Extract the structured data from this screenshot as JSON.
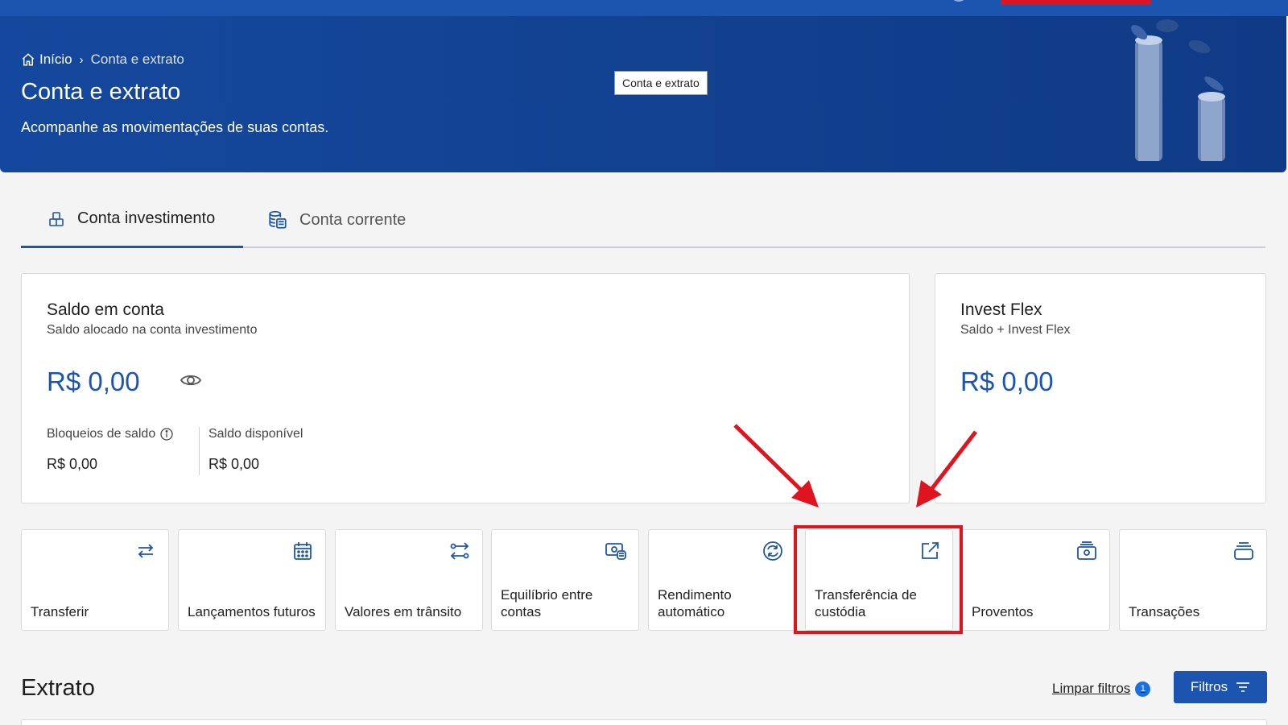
{
  "breadcrumb": {
    "home": "Início",
    "separator": "›",
    "current": "Conta e extrato"
  },
  "header": {
    "title": "Conta e extrato",
    "subtitle": "Acompanhe as movimentações de suas contas.",
    "tooltip": "Conta e extrato"
  },
  "tabs": [
    {
      "label": "Conta investimento",
      "icon": "investment-icon",
      "active": true
    },
    {
      "label": "Conta corrente",
      "icon": "coins-stack-icon",
      "active": false
    }
  ],
  "saldo": {
    "title": "Saldo em conta",
    "subtitle": "Saldo alocado na conta investimento",
    "value": "R$ 0,00",
    "bloqueios_label": "Bloqueios de saldo",
    "bloqueios_value": "R$ 0,00",
    "disponivel_label": "Saldo disponível",
    "disponivel_value": "R$ 0,00"
  },
  "invest_flex": {
    "title": "Invest Flex",
    "subtitle": "Saldo + Invest Flex",
    "value": "R$ 0,00"
  },
  "actions": [
    {
      "label": "Transferir",
      "icon": "transfer-arrows-icon"
    },
    {
      "label": "Lançamentos futuros",
      "icon": "calendar-icon"
    },
    {
      "label": "Valores em trânsito",
      "icon": "transit-arrows-icon"
    },
    {
      "label": "Equilíbrio entre contas",
      "icon": "money-balance-icon"
    },
    {
      "label": "Rendimento automático",
      "icon": "auto-yield-icon"
    },
    {
      "label": "Transferência de custódia",
      "icon": "external-link-icon"
    },
    {
      "label": "Proventos",
      "icon": "wallet-icon"
    },
    {
      "label": "Transações",
      "icon": "stack-icon"
    }
  ],
  "extrato": {
    "title": "Extrato",
    "clear_filters": "Limpar filtros",
    "filter_count": "1",
    "filters_button": "Filtros"
  },
  "colors": {
    "brand_blue": "#1c55b0",
    "hero_blue": "#14489e",
    "highlight_red": "#e0141e"
  }
}
